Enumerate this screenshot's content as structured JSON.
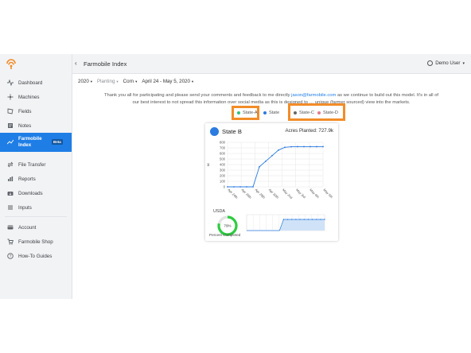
{
  "app": {
    "title": "Farmobile Index",
    "back_icon": "chevron-left-icon"
  },
  "user": {
    "name": "Demo User"
  },
  "sidebar": {
    "items": [
      {
        "label": "Dashboard",
        "icon": "pulse-icon"
      },
      {
        "label": "Machines",
        "icon": "machine-icon"
      },
      {
        "label": "Fields",
        "icon": "fields-icon"
      },
      {
        "label": "Notes",
        "icon": "notes-icon"
      },
      {
        "label": "Farmobile Index",
        "icon": "trend-icon",
        "badge": "Beta",
        "active": true
      },
      {
        "label": "File Transfer",
        "icon": "transfer-icon"
      },
      {
        "label": "Reports",
        "icon": "reports-icon"
      },
      {
        "label": "Downloads",
        "icon": "download-icon"
      },
      {
        "label": "Inputs",
        "icon": "inputs-icon"
      },
      {
        "label": "Account",
        "icon": "account-icon"
      },
      {
        "label": "Farmobile Shop",
        "icon": "cart-icon"
      },
      {
        "label": "How-To Guides",
        "icon": "help-icon"
      }
    ]
  },
  "filters": {
    "year": "2020",
    "activity": "Planting",
    "crop": "Corn",
    "range": "April 24 - May 5, 2020"
  },
  "intro": {
    "line1_a": "Thank you all for participating and please send your comments and feedback to me directly ",
    "email": "jason@farmobile.com",
    "line1_b": " as we continue to build out this model. It's in all of",
    "line2": "our best interest to not spread this information over social media as this is designed to … unique (farmer sourced) view into the markets."
  },
  "legend": [
    {
      "label": "State-A",
      "color": "#2ec27e"
    },
    {
      "label": "State",
      "color": "#2b7be0"
    },
    {
      "label": "State-C",
      "color": "#666666"
    },
    {
      "label": "State-D",
      "color": "#e57a8a"
    }
  ],
  "card": {
    "state": "State B",
    "acres": "Acres Planted: 727.9k",
    "usda_label": "USDA",
    "percent_label": "Percent Completed",
    "gauge_text": "79%"
  },
  "chart_data": [
    {
      "type": "line",
      "ylabel": "ac",
      "ylim": [
        0,
        800
      ],
      "yticks": [
        0,
        100,
        200,
        300,
        400,
        500,
        600,
        700,
        800
      ],
      "categories": [
        "Apr 24th",
        "Apr 26th",
        "Apr 28th",
        "Apr 30th",
        "May 2nd",
        "May 3rd",
        "May 4th",
        "May 5th"
      ],
      "series": [
        {
          "values": [
            0,
            0,
            0,
            0,
            0,
            360,
            460,
            560,
            660,
            710,
            720,
            722,
            722,
            722,
            722,
            722
          ]
        }
      ],
      "grid": true
    },
    {
      "type": "area",
      "gauge_percent": 79,
      "series": [
        {
          "values": [
            0,
            0,
            0,
            0,
            0,
            0,
            0,
            0,
            0,
            0.7,
            0.7,
            0.7,
            0.7,
            0.7,
            0.7,
            0.7,
            0.7,
            0.7,
            0.7,
            0.7
          ]
        }
      ]
    }
  ]
}
